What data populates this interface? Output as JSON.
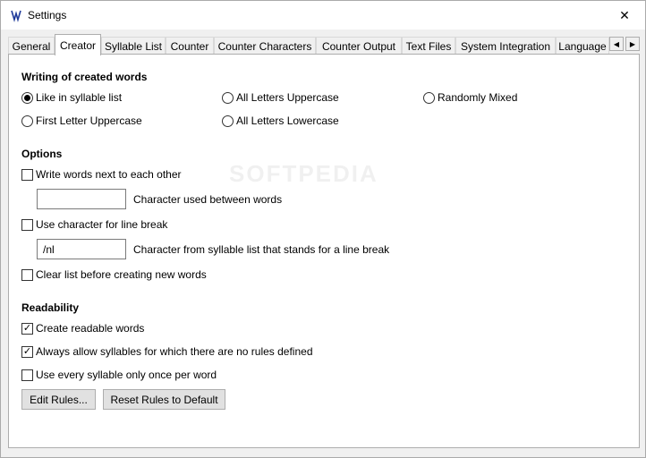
{
  "window": {
    "title": "Settings",
    "close_glyph": "✕"
  },
  "tabs": [
    "General",
    "Creator",
    "Syllable List",
    "Counter",
    "Counter Characters",
    "Counter Output",
    "Text Files",
    "System Integration",
    "Language"
  ],
  "active_tab": "Creator",
  "tab_scroll": {
    "left": "◀",
    "right": "▶"
  },
  "writing": {
    "title": "Writing of created words",
    "options": {
      "like_syllable": "Like in syllable list",
      "all_upper": "All Letters Uppercase",
      "random_mixed": "Randomly Mixed",
      "first_upper": "First Letter Uppercase",
      "all_lower": "All Letters Lowercase"
    },
    "selected": "like_syllable"
  },
  "options": {
    "title": "Options",
    "next_to_each_other": "Write words next to each other",
    "between_char_value": "",
    "between_char_label": "Character used between words",
    "use_line_break": "Use character for line break",
    "line_break_value": "/nl",
    "line_break_label": "Character from syllable list that stands for a line break",
    "clear_list": "Clear list before creating new words"
  },
  "readability": {
    "title": "Readability",
    "create_readable": "Create readable words",
    "allow_undefined": "Always allow syllables for which there are no rules defined",
    "once_per_word": "Use every syllable only once per word",
    "edit_rules": "Edit Rules...",
    "reset_rules": "Reset Rules to Default"
  },
  "checks": {
    "mark": "✓"
  },
  "watermark": "SOFTPEDIA"
}
